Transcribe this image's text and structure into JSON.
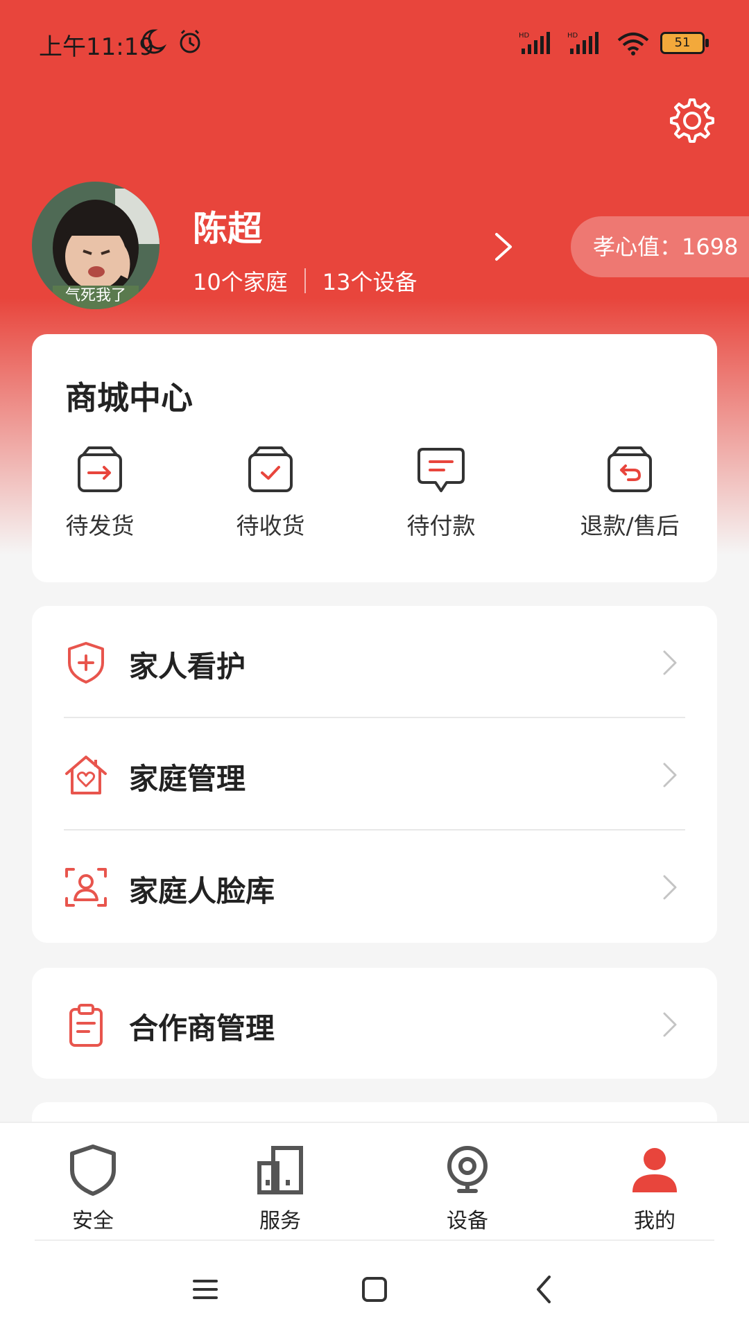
{
  "status_bar": {
    "time": "上午11:19",
    "battery": "51",
    "signal_label": "HD"
  },
  "profile": {
    "name": "陈超",
    "families": "10个家庭",
    "devices": "13个设备",
    "avatar_caption": "气死我了",
    "xiaoxin_value": "孝心值：1698"
  },
  "mall": {
    "title": "商城中心",
    "items": [
      {
        "label": "待发货",
        "icon": "box-arrow-icon"
      },
      {
        "label": "待收货",
        "icon": "box-check-icon"
      },
      {
        "label": "待付款",
        "icon": "message-icon"
      },
      {
        "label": "退款/售后",
        "icon": "box-return-icon"
      }
    ]
  },
  "menu": {
    "family_care": "家人看护",
    "family_manage": "家庭管理",
    "face_library": "家庭人脸库",
    "partner_manage": "合作商管理"
  },
  "tabs": [
    {
      "label": "安全",
      "icon": "shield-icon"
    },
    {
      "label": "服务",
      "icon": "building-icon"
    },
    {
      "label": "设备",
      "icon": "camera-icon"
    },
    {
      "label": "我的",
      "icon": "person-icon",
      "active": true
    }
  ],
  "colors": {
    "brand_red": "#e8453c",
    "icon_red": "#e8554d",
    "tab_gray": "#555555"
  }
}
